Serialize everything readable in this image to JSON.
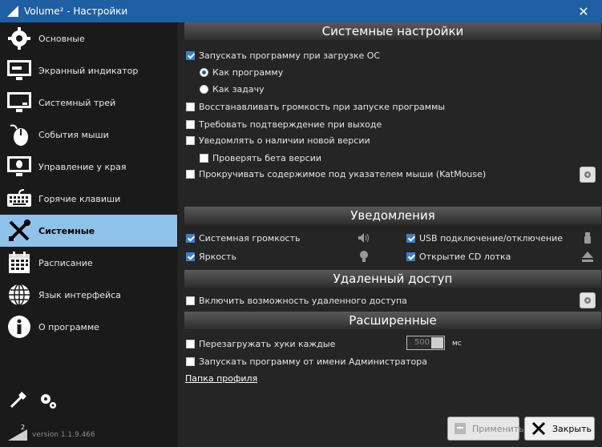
{
  "window": {
    "title": "Volume² - Настройки"
  },
  "sidebar": {
    "items": [
      {
        "label": "Основные",
        "icon": "gear-icon"
      },
      {
        "label": "Экранный индикатор",
        "icon": "monitor-indicator-icon"
      },
      {
        "label": "Системный трей",
        "icon": "monitor-tray-icon"
      },
      {
        "label": "События мыши",
        "icon": "mouse-icon"
      },
      {
        "label": "Управление у края",
        "icon": "screen-edge-icon"
      },
      {
        "label": "Горячие клавиши",
        "icon": "keyboard-icon"
      },
      {
        "label": "Системные",
        "icon": "tools-icon"
      },
      {
        "label": "Расписание",
        "icon": "calendar-icon"
      },
      {
        "label": "Язык интерфейса",
        "icon": "globe-icon"
      },
      {
        "label": "О программе",
        "icon": "info-icon"
      }
    ],
    "active_index": 6,
    "version": "version 1.1.9.466"
  },
  "sections": {
    "system": {
      "title": "Системные настройки",
      "autostart": {
        "label": "Запускать программу при загрузке ОС",
        "checked": true
      },
      "as_program": {
        "label": "Как программу",
        "selected": true
      },
      "as_task": {
        "label": "Как задачу",
        "selected": false
      },
      "restore_volume": {
        "label": "Восстанавливать громкость при запуске программы",
        "checked": false
      },
      "confirm_exit": {
        "label": "Требовать подтверждение при выходе",
        "checked": false
      },
      "notify_update": {
        "label": "Уведомлять о наличии новой версии",
        "checked": false
      },
      "beta": {
        "label": "Проверять бета версии",
        "checked": false
      },
      "katmouse": {
        "label": "Прокручивать содержимое под указателем мыши (KatMouse)",
        "checked": false
      }
    },
    "notifications": {
      "title": "Уведомления",
      "system_volume": {
        "label": "Системная громкость",
        "checked": true
      },
      "usb": {
        "label": "USB подключение/отключение",
        "checked": true
      },
      "brightness": {
        "label": "Яркость",
        "checked": true
      },
      "cd_tray": {
        "label": "Открытие CD лотка",
        "checked": true
      }
    },
    "remote": {
      "title": "Удаленный доступ",
      "enable": {
        "label": "Включить возможность удаленного доступа",
        "checked": false
      }
    },
    "advanced": {
      "title": "Расширенные",
      "reload_hooks": {
        "label": "Перезагружать хуки каждые",
        "checked": false
      },
      "hooks_value": "500",
      "hooks_unit": "мс",
      "run_as_admin": {
        "label": "Запускать программу от имени Администратора",
        "checked": false
      },
      "profile_link": "Папка профиля"
    }
  },
  "buttons": {
    "apply": "Применить",
    "close": "Закрыть"
  },
  "colors": {
    "titlebar": "#1f5fa3",
    "active_item": "#8ec2ea",
    "check": "#3a7fd1"
  }
}
